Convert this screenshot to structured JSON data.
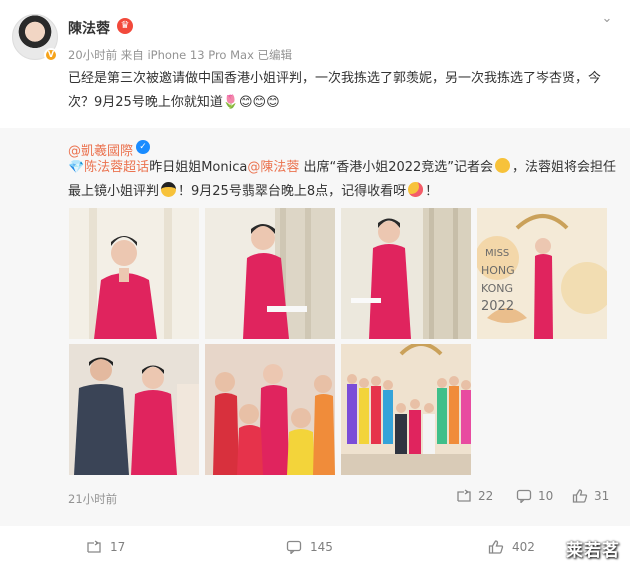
{
  "header": {
    "username": "陳法蓉",
    "meta": "20小时前  来自 iPhone 13 Pro Max 已编辑"
  },
  "post": {
    "text": "已经是第三次被邀请做中国香港小姐评判，一次我拣选了郭羡妮，另一次我拣选了岑杏贤，今次？9月25号晚上你就知道🌷😊😊😊"
  },
  "repost": {
    "author": "@凱羲國際",
    "text_parts": {
      "p1": "💎陈法蓉超话",
      "p2": "昨日姐姐Monica",
      "p3": "@陳法蓉",
      "p4": " 出席“香港小姐2022竞选”记者会",
      "p5": "，法蓉姐将会担任最上镜小姐评判",
      "p6": "！9月25号翡翠台晚上8点，记得收看呀",
      "p7": "！"
    },
    "time": "21小时前",
    "reposts": "22",
    "comments": "10",
    "likes": "31"
  },
  "footer": {
    "reposts": "17",
    "comments": "145",
    "likes": "402"
  },
  "watermark": "莱若茗",
  "colors": {
    "link": "#eb7350",
    "verify": "#1a8cff",
    "pink_suit": "#e0245e"
  },
  "icons": [
    "more-icon",
    "repost-icon",
    "comment-icon",
    "like-icon"
  ]
}
